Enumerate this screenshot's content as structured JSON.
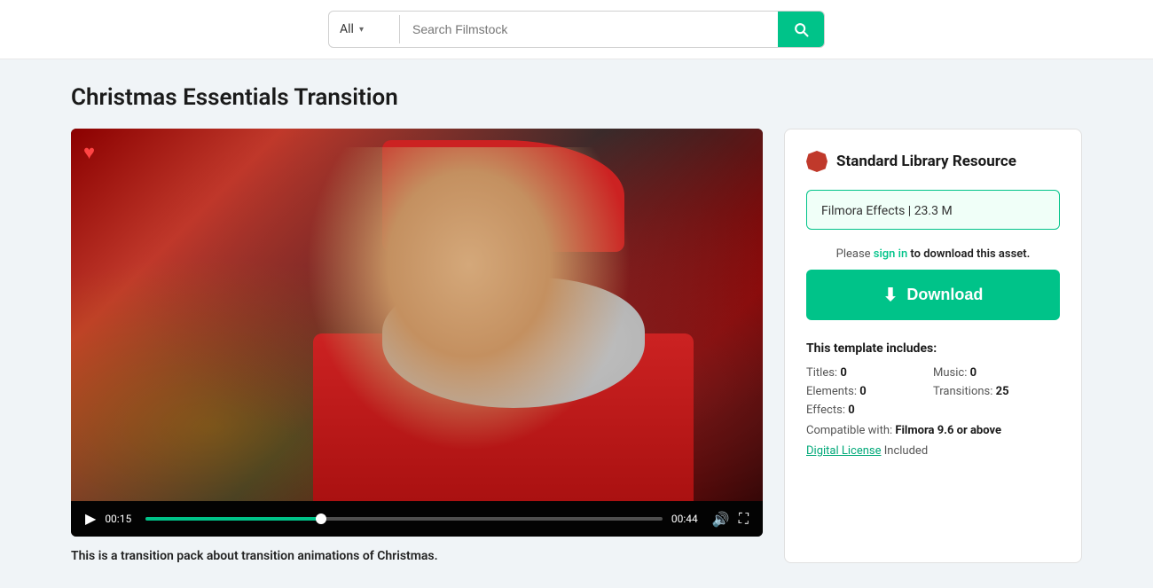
{
  "header": {
    "search_category": "All",
    "search_placeholder": "Search Filmstock",
    "search_icon": "search-icon"
  },
  "page": {
    "title": "Christmas Essentials Transition"
  },
  "video": {
    "current_time": "00:15",
    "total_time": "00:44",
    "progress_percent": 34,
    "heart_icon": "♥",
    "play_icon": "▶",
    "volume_icon": "🔊",
    "fullscreen_icon": "⛶"
  },
  "description": "This is a transition pack about transition animations of Christmas.",
  "panel": {
    "resource_label": "Standard Library Resource",
    "file_info": "Filmora Effects | 23.3 M",
    "sign_in_notice_pre": "Please ",
    "sign_in_text": "sign in",
    "sign_in_notice_post": " to download this asset.",
    "download_label": "Download",
    "template_includes_label": "This template includes:",
    "items": [
      {
        "label": "Titles:",
        "value": "0"
      },
      {
        "label": "Music:",
        "value": "0"
      },
      {
        "label": "Elements:",
        "value": "0"
      },
      {
        "label": "Transitions:",
        "value": "25"
      },
      {
        "label": "Effects:",
        "value": "0"
      }
    ],
    "compatible_pre": "Compatible with: ",
    "compatible_value": "Filmora 9.6 or above",
    "license_link_text": "Digital License",
    "license_suffix": " Included"
  }
}
